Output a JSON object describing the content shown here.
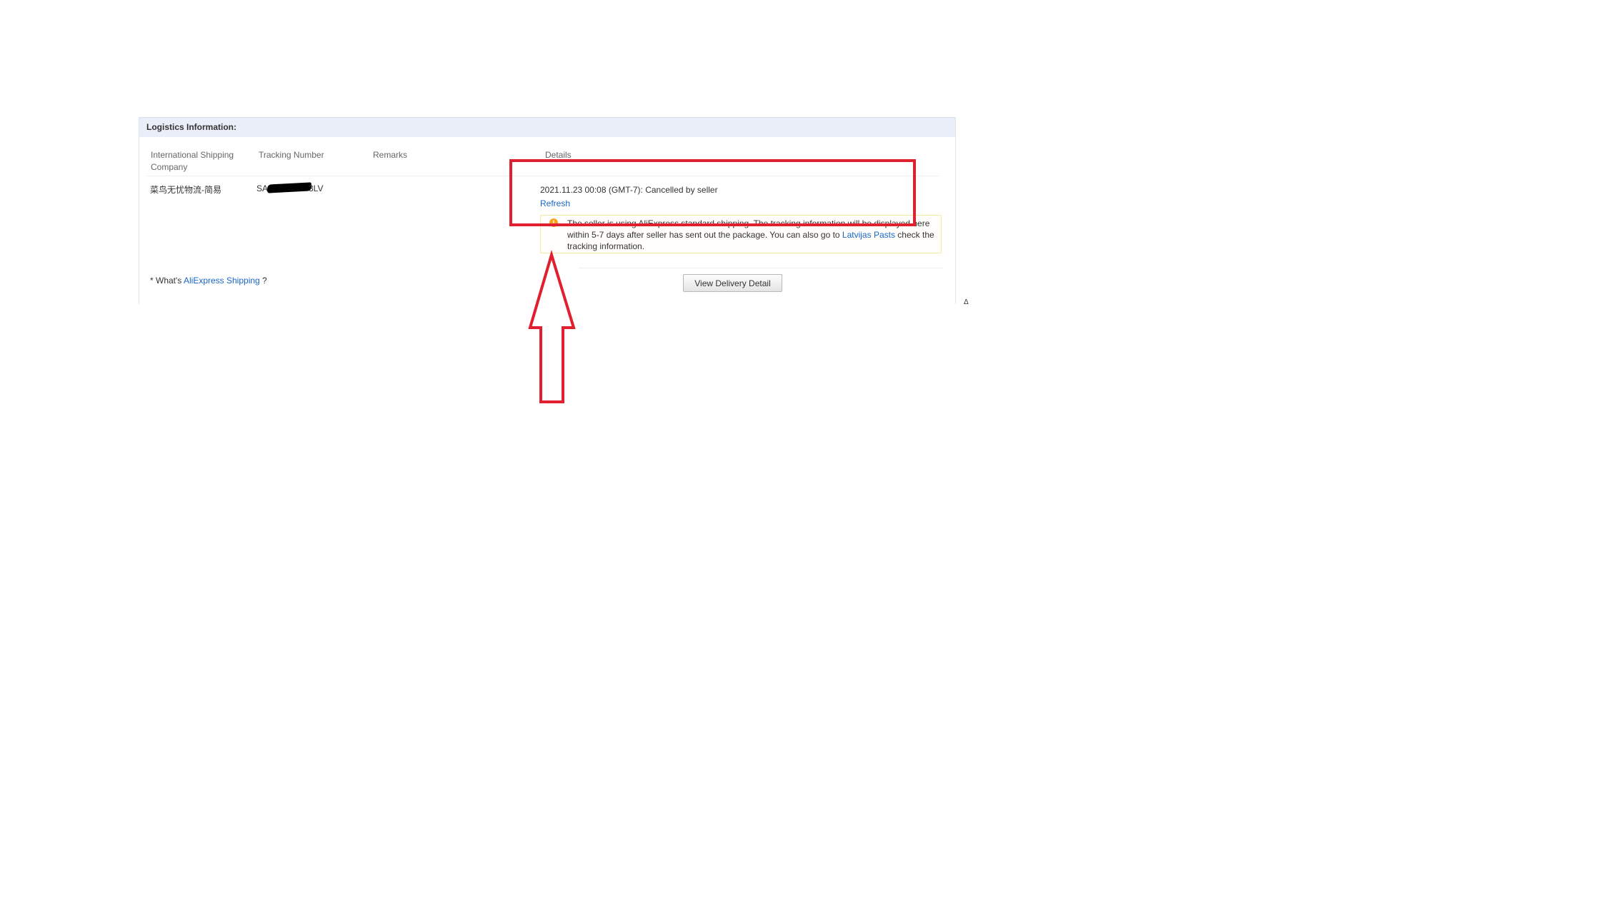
{
  "logistics": {
    "title": "Logistics Information:",
    "columns": {
      "company": "International Shipping\nCompany",
      "tracking": "Tracking Number",
      "remarks": "Remarks",
      "details": "Details"
    },
    "row": {
      "company": "菜鸟无忧物流-简易",
      "tracking_prefix": "SA",
      "tracking_suffix": "3LV",
      "remarks": "",
      "status": "2021.11.23 00:08 (GMT-7): Cancelled by seller",
      "refresh_label": "Refresh"
    },
    "notice": {
      "icon": "warning-icon",
      "text_1": "The seller is using AliExpress standard shipping. The tracking information will be displayed here within 5-7 days after seller has sent out the package. You can also go to ",
      "link": "Latvijas Pasts",
      "text_2": " check the tracking information."
    },
    "footer": {
      "prefix": "* What's ",
      "link": "AliExpress Shipping",
      "suffix": " ?"
    },
    "view_delivery_label": "View Delivery Detail",
    "corner_glyph": "Δ"
  },
  "annotation": {
    "color": "#e0202e"
  }
}
